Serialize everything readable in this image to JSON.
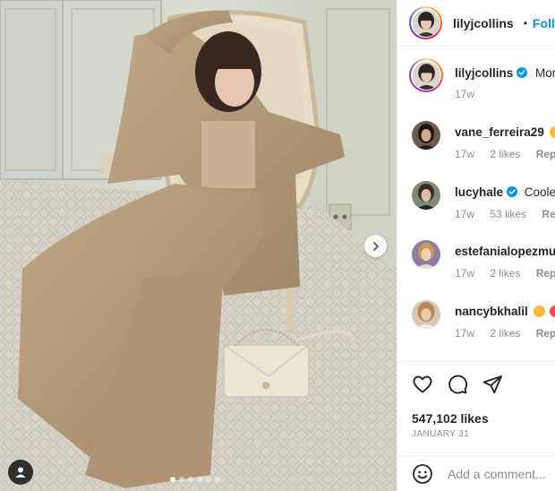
{
  "post": {
    "author": "lilyjcollins",
    "follow_label": "Follow",
    "caption_preview": "Mon",
    "caption_age": "17w",
    "carousel": {
      "slide_count": 6,
      "active_index": 0
    }
  },
  "comments": [
    {
      "user": "vane_ferreira29",
      "text": "",
      "age": "17w",
      "likes": "2 likes",
      "reply": "Reply",
      "emoji": "heart-eyes"
    },
    {
      "user": "lucyhale",
      "text": "Coolest",
      "age": "17w",
      "likes": "53 likes",
      "reply": "Reply",
      "verified": true
    },
    {
      "user": "estefanialopezmu",
      "text": "",
      "age": "17w",
      "likes": "2 likes",
      "reply": "Reply"
    },
    {
      "user": "nancybkhalil",
      "text": "",
      "age": "17w",
      "likes": "2 likes",
      "reply": "Reply",
      "emoji": "heart-eyes"
    }
  ],
  "engagement": {
    "likes_count": "547,102 likes",
    "date": "JANUARY 31"
  },
  "composer": {
    "placeholder": "Add a comment..."
  },
  "icons": {
    "like": "heart-icon",
    "comment": "comment-icon",
    "share": "share-icon",
    "next": "chevron-right-icon",
    "tag": "user-tag-icon",
    "emoji": "emoji-icon",
    "verified": "verified-badge-icon"
  },
  "colors": {
    "accent": "#0095f6",
    "text": "#262626",
    "muted": "#8e8e8e",
    "divider": "#efefef"
  }
}
